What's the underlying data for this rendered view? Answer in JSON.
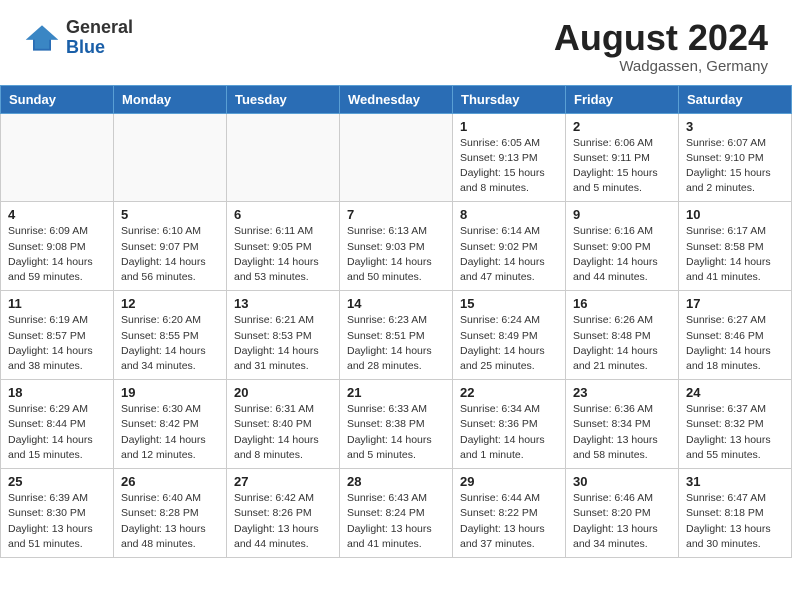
{
  "header": {
    "logo_general": "General",
    "logo_blue": "Blue",
    "month_year": "August 2024",
    "location": "Wadgassen, Germany"
  },
  "weekdays": [
    "Sunday",
    "Monday",
    "Tuesday",
    "Wednesday",
    "Thursday",
    "Friday",
    "Saturday"
  ],
  "weeks": [
    [
      {
        "day": "",
        "info": ""
      },
      {
        "day": "",
        "info": ""
      },
      {
        "day": "",
        "info": ""
      },
      {
        "day": "",
        "info": ""
      },
      {
        "day": "1",
        "info": "Sunrise: 6:05 AM\nSunset: 9:13 PM\nDaylight: 15 hours\nand 8 minutes."
      },
      {
        "day": "2",
        "info": "Sunrise: 6:06 AM\nSunset: 9:11 PM\nDaylight: 15 hours\nand 5 minutes."
      },
      {
        "day": "3",
        "info": "Sunrise: 6:07 AM\nSunset: 9:10 PM\nDaylight: 15 hours\nand 2 minutes."
      }
    ],
    [
      {
        "day": "4",
        "info": "Sunrise: 6:09 AM\nSunset: 9:08 PM\nDaylight: 14 hours\nand 59 minutes."
      },
      {
        "day": "5",
        "info": "Sunrise: 6:10 AM\nSunset: 9:07 PM\nDaylight: 14 hours\nand 56 minutes."
      },
      {
        "day": "6",
        "info": "Sunrise: 6:11 AM\nSunset: 9:05 PM\nDaylight: 14 hours\nand 53 minutes."
      },
      {
        "day": "7",
        "info": "Sunrise: 6:13 AM\nSunset: 9:03 PM\nDaylight: 14 hours\nand 50 minutes."
      },
      {
        "day": "8",
        "info": "Sunrise: 6:14 AM\nSunset: 9:02 PM\nDaylight: 14 hours\nand 47 minutes."
      },
      {
        "day": "9",
        "info": "Sunrise: 6:16 AM\nSunset: 9:00 PM\nDaylight: 14 hours\nand 44 minutes."
      },
      {
        "day": "10",
        "info": "Sunrise: 6:17 AM\nSunset: 8:58 PM\nDaylight: 14 hours\nand 41 minutes."
      }
    ],
    [
      {
        "day": "11",
        "info": "Sunrise: 6:19 AM\nSunset: 8:57 PM\nDaylight: 14 hours\nand 38 minutes."
      },
      {
        "day": "12",
        "info": "Sunrise: 6:20 AM\nSunset: 8:55 PM\nDaylight: 14 hours\nand 34 minutes."
      },
      {
        "day": "13",
        "info": "Sunrise: 6:21 AM\nSunset: 8:53 PM\nDaylight: 14 hours\nand 31 minutes."
      },
      {
        "day": "14",
        "info": "Sunrise: 6:23 AM\nSunset: 8:51 PM\nDaylight: 14 hours\nand 28 minutes."
      },
      {
        "day": "15",
        "info": "Sunrise: 6:24 AM\nSunset: 8:49 PM\nDaylight: 14 hours\nand 25 minutes."
      },
      {
        "day": "16",
        "info": "Sunrise: 6:26 AM\nSunset: 8:48 PM\nDaylight: 14 hours\nand 21 minutes."
      },
      {
        "day": "17",
        "info": "Sunrise: 6:27 AM\nSunset: 8:46 PM\nDaylight: 14 hours\nand 18 minutes."
      }
    ],
    [
      {
        "day": "18",
        "info": "Sunrise: 6:29 AM\nSunset: 8:44 PM\nDaylight: 14 hours\nand 15 minutes."
      },
      {
        "day": "19",
        "info": "Sunrise: 6:30 AM\nSunset: 8:42 PM\nDaylight: 14 hours\nand 12 minutes."
      },
      {
        "day": "20",
        "info": "Sunrise: 6:31 AM\nSunset: 8:40 PM\nDaylight: 14 hours\nand 8 minutes."
      },
      {
        "day": "21",
        "info": "Sunrise: 6:33 AM\nSunset: 8:38 PM\nDaylight: 14 hours\nand 5 minutes."
      },
      {
        "day": "22",
        "info": "Sunrise: 6:34 AM\nSunset: 8:36 PM\nDaylight: 14 hours\nand 1 minute."
      },
      {
        "day": "23",
        "info": "Sunrise: 6:36 AM\nSunset: 8:34 PM\nDaylight: 13 hours\nand 58 minutes."
      },
      {
        "day": "24",
        "info": "Sunrise: 6:37 AM\nSunset: 8:32 PM\nDaylight: 13 hours\nand 55 minutes."
      }
    ],
    [
      {
        "day": "25",
        "info": "Sunrise: 6:39 AM\nSunset: 8:30 PM\nDaylight: 13 hours\nand 51 minutes."
      },
      {
        "day": "26",
        "info": "Sunrise: 6:40 AM\nSunset: 8:28 PM\nDaylight: 13 hours\nand 48 minutes."
      },
      {
        "day": "27",
        "info": "Sunrise: 6:42 AM\nSunset: 8:26 PM\nDaylight: 13 hours\nand 44 minutes."
      },
      {
        "day": "28",
        "info": "Sunrise: 6:43 AM\nSunset: 8:24 PM\nDaylight: 13 hours\nand 41 minutes."
      },
      {
        "day": "29",
        "info": "Sunrise: 6:44 AM\nSunset: 8:22 PM\nDaylight: 13 hours\nand 37 minutes."
      },
      {
        "day": "30",
        "info": "Sunrise: 6:46 AM\nSunset: 8:20 PM\nDaylight: 13 hours\nand 34 minutes."
      },
      {
        "day": "31",
        "info": "Sunrise: 6:47 AM\nSunset: 8:18 PM\nDaylight: 13 hours\nand 30 minutes."
      }
    ]
  ]
}
